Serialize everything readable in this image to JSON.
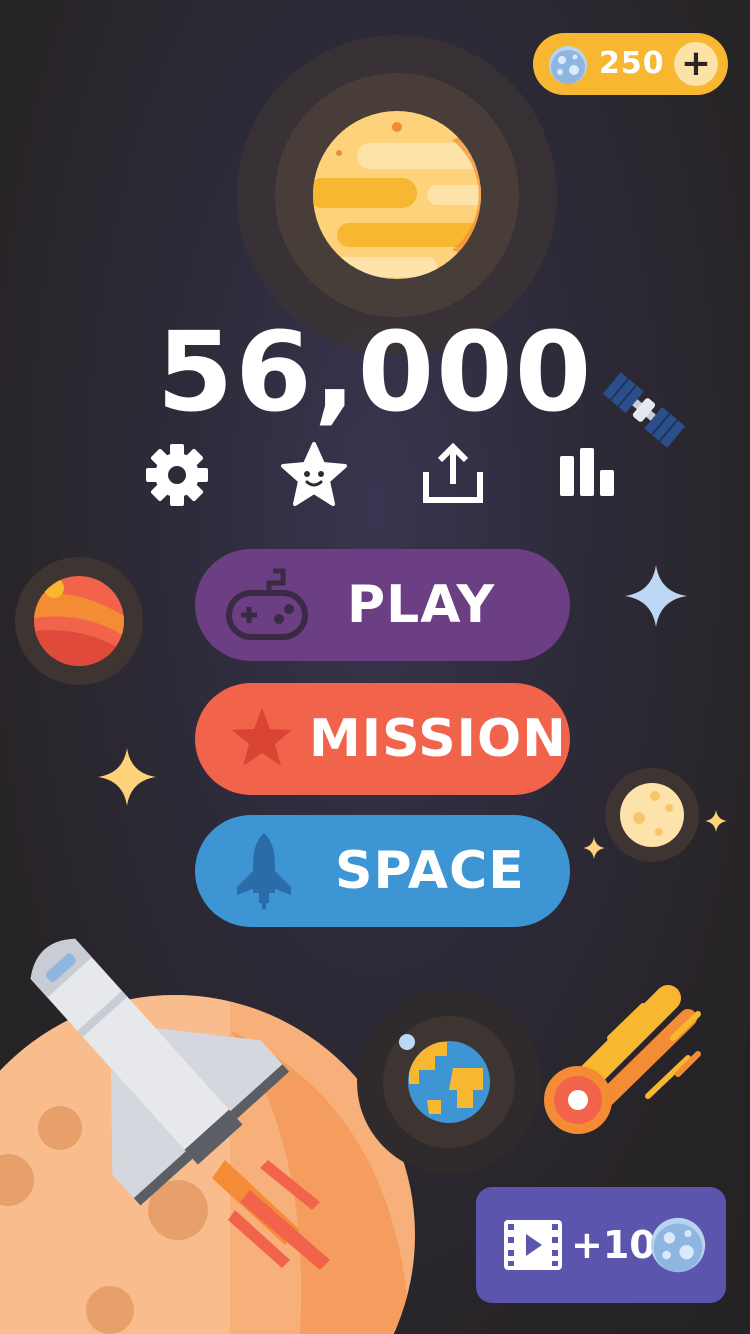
{
  "currency": {
    "balance": "250",
    "add_label": "+",
    "icon": "asteroid-coin-icon",
    "color": "#f7b731"
  },
  "score": "56,000",
  "toolbar": {
    "items": [
      {
        "icon": "gear-icon",
        "name": "settings"
      },
      {
        "icon": "star-face-icon",
        "name": "rate"
      },
      {
        "icon": "share-icon",
        "name": "share"
      },
      {
        "icon": "leaderboard-icon",
        "name": "leaderboard"
      }
    ]
  },
  "menu": {
    "play": {
      "label": "PLAY",
      "icon": "gamepad-icon",
      "color": "#6c3f85"
    },
    "mission": {
      "label": "MISSION",
      "icon": "star-icon",
      "color": "#f2634c"
    },
    "space": {
      "label": "SPACE",
      "icon": "rocket-icon",
      "color": "#3d95d4"
    }
  },
  "reward": {
    "label": "+10",
    "icon": "video-icon",
    "reward_icon": "asteroid-coin-icon",
    "color": "#5b55ad"
  },
  "decorations": [
    "planet-jupiter",
    "planet-mars",
    "moon",
    "earth",
    "satellite",
    "comet",
    "space-shuttle",
    "sparkle-stars"
  ]
}
